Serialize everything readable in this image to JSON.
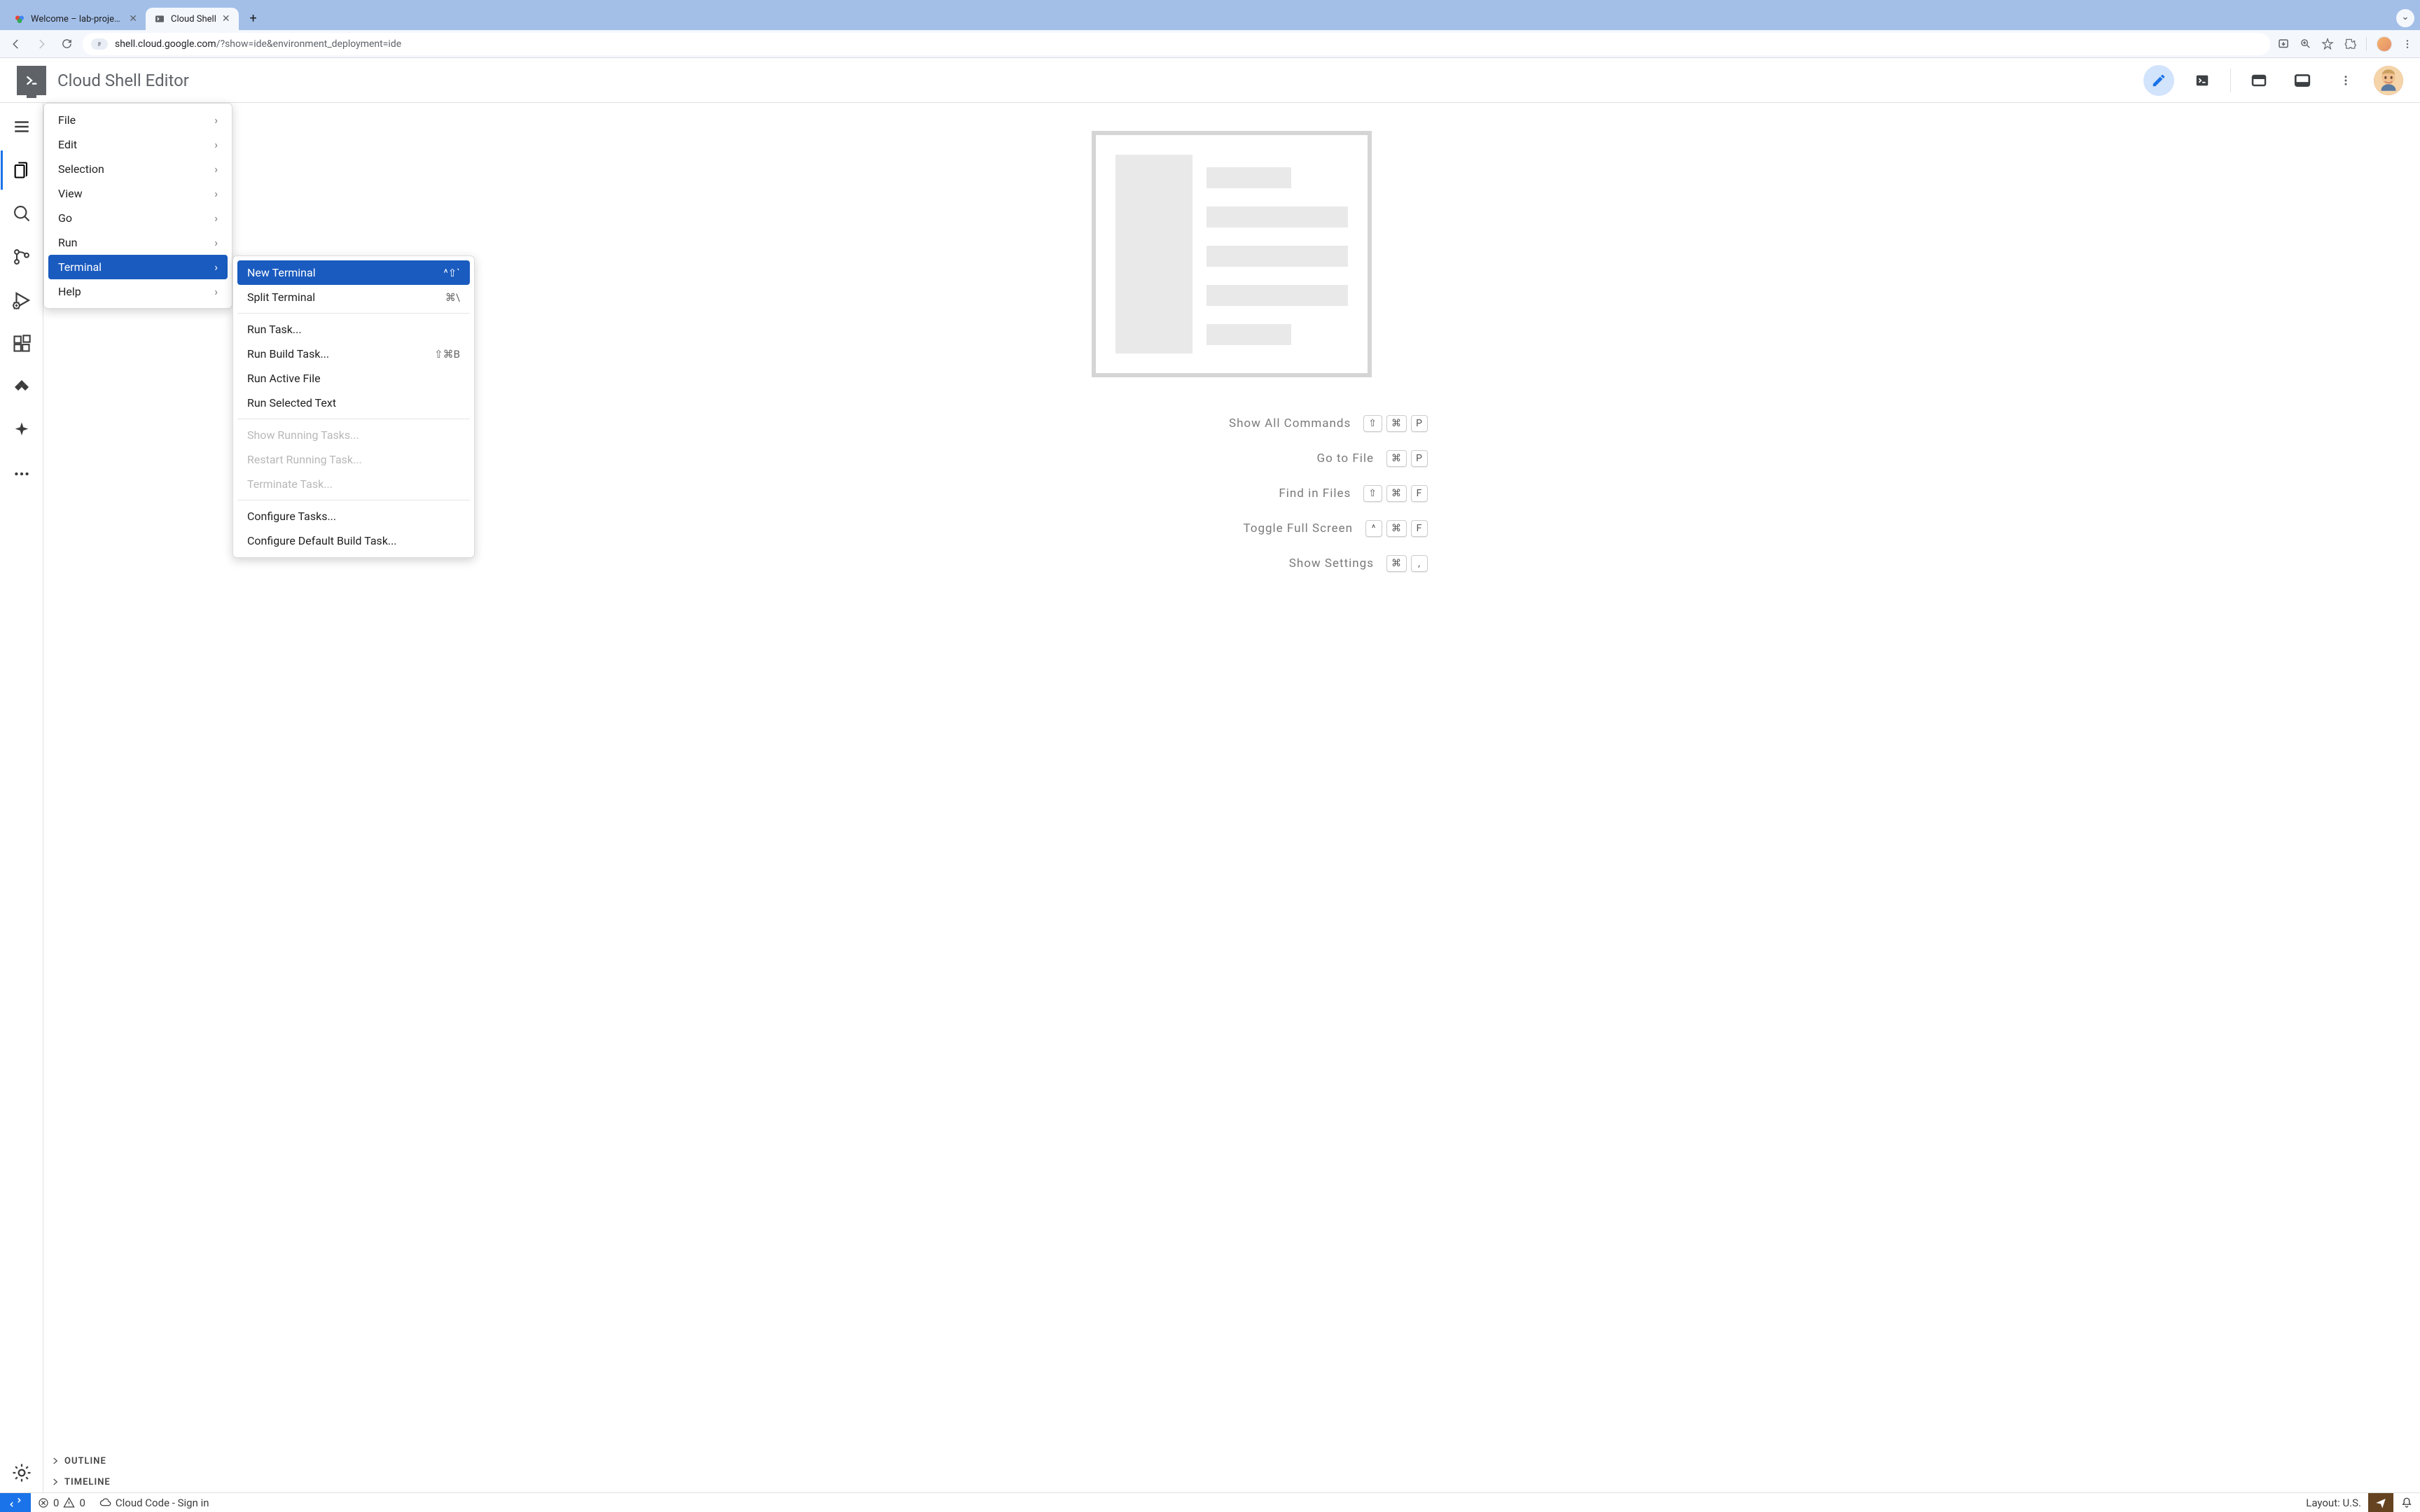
{
  "browser": {
    "tabs": [
      {
        "title": "Welcome – lab-project-id-ex",
        "active": false
      },
      {
        "title": "Cloud Shell",
        "active": true
      }
    ],
    "url_host": "shell.cloud.google.com",
    "url_path": "/?show=ide&environment_deployment=ide"
  },
  "header": {
    "title": "Cloud Shell Editor"
  },
  "menu": {
    "items": [
      {
        "label": "File"
      },
      {
        "label": "Edit"
      },
      {
        "label": "Selection"
      },
      {
        "label": "View"
      },
      {
        "label": "Go"
      },
      {
        "label": "Run"
      },
      {
        "label": "Terminal"
      },
      {
        "label": "Help"
      }
    ]
  },
  "submenu": {
    "group1": [
      {
        "label": "New Terminal",
        "shortcut": "^⇧`"
      },
      {
        "label": "Split Terminal",
        "shortcut": "⌘\\"
      }
    ],
    "group2": [
      {
        "label": "Run Task...",
        "shortcut": ""
      },
      {
        "label": "Run Build Task...",
        "shortcut": "⇧⌘B"
      },
      {
        "label": "Run Active File",
        "shortcut": ""
      },
      {
        "label": "Run Selected Text",
        "shortcut": ""
      }
    ],
    "group3": [
      {
        "label": "Show Running Tasks...",
        "shortcut": ""
      },
      {
        "label": "Restart Running Task...",
        "shortcut": ""
      },
      {
        "label": "Terminate Task...",
        "shortcut": ""
      }
    ],
    "group4": [
      {
        "label": "Configure Tasks...",
        "shortcut": ""
      },
      {
        "label": "Configure Default Build Task...",
        "shortcut": ""
      }
    ]
  },
  "welcome": {
    "rows": [
      {
        "label": "Show All Commands",
        "keys": [
          "⇧",
          "⌘",
          "P"
        ]
      },
      {
        "label": "Go to File",
        "keys": [
          "⌘",
          "P"
        ]
      },
      {
        "label": "Find in Files",
        "keys": [
          "⇧",
          "⌘",
          "F"
        ]
      },
      {
        "label": "Toggle Full Screen",
        "keys": [
          "^",
          "⌘",
          "F"
        ]
      },
      {
        "label": "Show Settings",
        "keys": [
          "⌘",
          ","
        ]
      }
    ]
  },
  "panels": {
    "outline": "OUTLINE",
    "timeline": "TIMELINE"
  },
  "statusbar": {
    "errors": "0",
    "warnings": "0",
    "cloudcode": "Cloud Code - Sign in",
    "layout": "Layout: U.S."
  }
}
